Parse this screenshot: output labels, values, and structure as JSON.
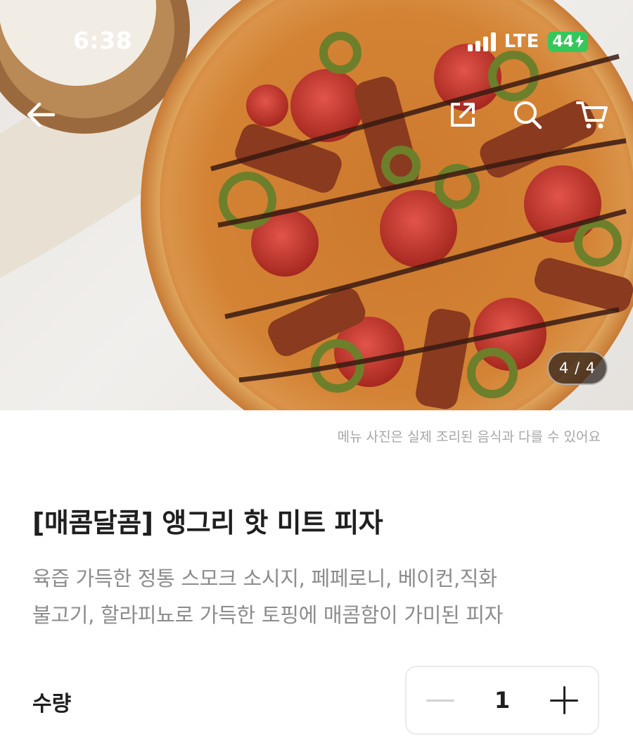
{
  "status_bar": {
    "time": "6:38",
    "network": "LTE",
    "battery": "44"
  },
  "header": {
    "back_icon": "arrow-left-icon",
    "share_icon": "share-external-icon",
    "search_icon": "search-icon",
    "cart_icon": "cart-icon"
  },
  "gallery": {
    "counter": "4 / 4",
    "current": 4,
    "total": 4
  },
  "product": {
    "disclaimer": "메뉴 사진은 실제 조리된 음식과 다를 수 있어요",
    "title": "[매콤달콤] 앵그리 핫 미트 피자",
    "description_line1": "육즙 가득한 정통 스모크 소시지, 페페로니, 베이컨,직화",
    "description_line2": "불고기, 할라피뇨로 가득한 토핑에 매콤함이 가미된 피자"
  },
  "quantity": {
    "label": "수량",
    "value": "1"
  },
  "colors": {
    "battery_green": "#35c759",
    "title_text": "#1f1f1f",
    "muted_text": "#8c8c8c"
  }
}
